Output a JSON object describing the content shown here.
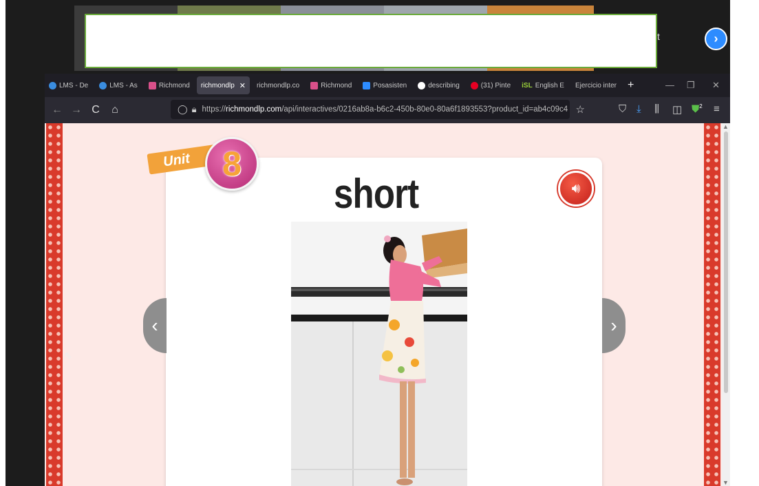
{
  "video": {
    "trailing_text": "t",
    "next_arrow": "›"
  },
  "browser": {
    "tabs": [
      {
        "label": "LMS - De",
        "icon_color": "#3a8de0",
        "active": false
      },
      {
        "label": "LMS - As",
        "icon_color": "#3a8de0",
        "active": false
      },
      {
        "label": "Richmond",
        "icon_color": "#d9508a",
        "active": false
      },
      {
        "label": "richmondlp",
        "icon_color": "",
        "active": true
      },
      {
        "label": "richmondlp.co",
        "icon_color": "",
        "active": false
      },
      {
        "label": "Richmond",
        "icon_color": "#d9508a",
        "active": false
      },
      {
        "label": "Posasisten",
        "icon_color": "#2d8cff",
        "active": false
      },
      {
        "label": "describing",
        "icon_color": "#ffffff",
        "active": false
      },
      {
        "label": "(31) Pinte",
        "icon_color": "#e60023",
        "active": false
      },
      {
        "label": "English E",
        "icon_color": "",
        "prefix": "iSL",
        "active": false
      },
      {
        "label": "Ejercicio inter",
        "icon_color": "",
        "active": false
      }
    ],
    "new_tab": "+",
    "url_prefix": "https://",
    "url_domain": "richmondlp.com",
    "url_path": "/api/interactives/0216ab8a-b6c2-450b-80e0-80a6f1893553?product_id=ab4c09c4",
    "ext_badge": "2"
  },
  "lesson": {
    "unit_label": "Unit",
    "unit_number": "8",
    "word": "short",
    "colors": {
      "card_bg": "#ffffff",
      "page_bg": "#fde9e6",
      "border": "#d93a2b",
      "unit_orange": "#f2a23a",
      "unit_pink": "#c2327e"
    }
  }
}
